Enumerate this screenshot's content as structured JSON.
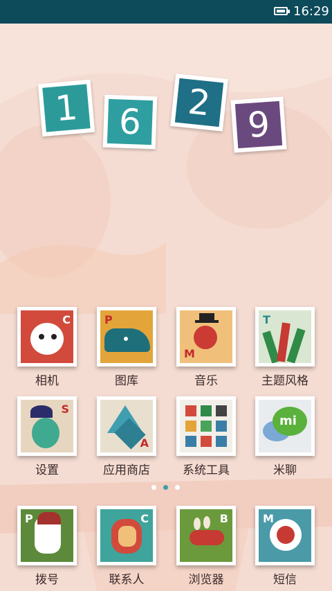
{
  "status_bar": {
    "time": "16:29",
    "battery_icon": "battery-full-icon"
  },
  "clock": {
    "digits": [
      "1",
      "6",
      "2",
      "9"
    ],
    "colors": [
      "#2d9a9a",
      "#2f9ea0",
      "#1f6f86",
      "#6a4a7e"
    ]
  },
  "apps": [
    {
      "label": "相机",
      "letter": "C",
      "icon": "camera-icon",
      "color": "#d24a3c"
    },
    {
      "label": "图库",
      "letter": "P",
      "icon": "gallery-icon",
      "color": "#e3a43a"
    },
    {
      "label": "音乐",
      "letter": "M",
      "icon": "music-icon",
      "color": "#f0c07a"
    },
    {
      "label": "主题风格",
      "letter": "T",
      "icon": "themes-icon",
      "color": "#d9e7d2"
    },
    {
      "label": "设置",
      "letter": "S",
      "icon": "settings-icon",
      "color": "#e7d6bf"
    },
    {
      "label": "应用商店",
      "letter": "A",
      "icon": "app-store-icon",
      "color": "#e9dfcf"
    },
    {
      "label": "系统工具",
      "letter": "",
      "icon": "system-tools-icon",
      "color": "#f2efe8"
    },
    {
      "label": "米聊",
      "letter": "",
      "icon": "mitalk-icon",
      "color": "#e8ecee"
    },
    {
      "label": "拨号",
      "letter": "P",
      "icon": "phone-icon",
      "color": "#5c8a3a"
    },
    {
      "label": "联系人",
      "letter": "C",
      "icon": "contacts-icon",
      "color": "#3fa49b"
    },
    {
      "label": "浏览器",
      "letter": "B",
      "icon": "browser-icon",
      "color": "#6a9a3c"
    },
    {
      "label": "短信",
      "letter": "M",
      "icon": "messaging-icon",
      "color": "#4a9aa8"
    }
  ],
  "pagination": {
    "pages": 3,
    "active": 2
  }
}
